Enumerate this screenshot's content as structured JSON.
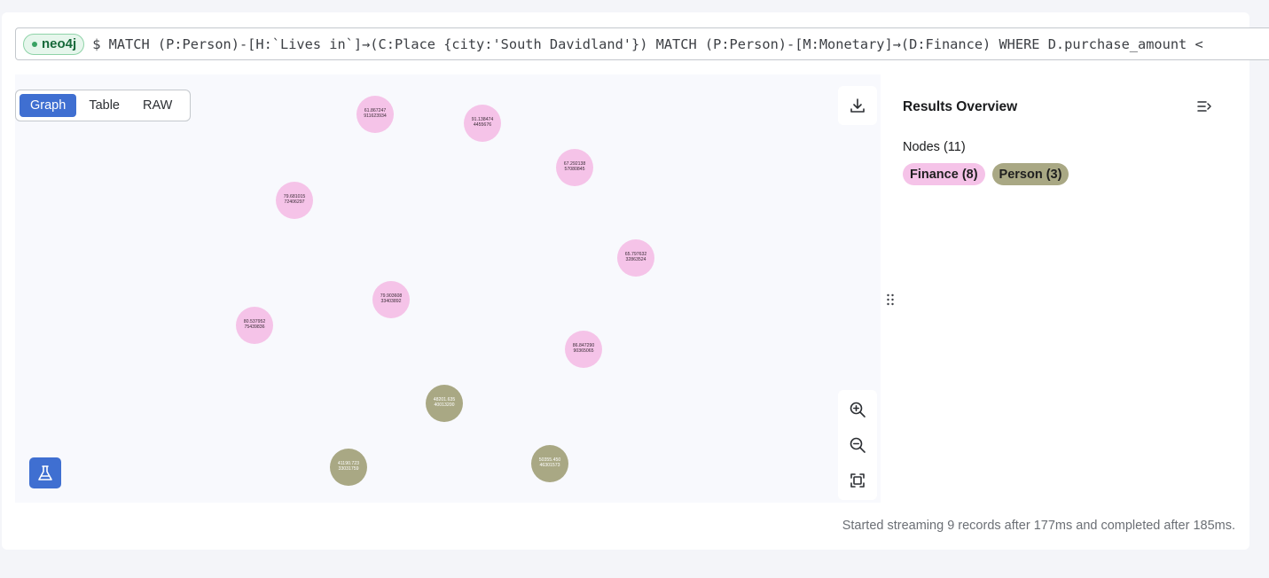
{
  "query_bar": {
    "database_badge": "neo4j",
    "query": "$ MATCH (P:Person)-[H:`Lives in`]→(C:Place {city:'South Davidland'}) MATCH (P:Person)-[M:Monetary]→(D:Finance) WHERE D.purchase_amount <"
  },
  "view_tabs": [
    "Graph",
    "Table",
    "RAW"
  ],
  "active_view": "Graph",
  "icons": {
    "download": "download-icon",
    "zoom_in": "zoom-in-icon",
    "zoom_out": "zoom-out-icon",
    "fit": "zoom-to-fit-icon",
    "sandbox": "flask-icon",
    "collapse": "collapse-panel-icon"
  },
  "graph": {
    "nodes": [
      {
        "label": "Finance",
        "line1": "61.867247",
        "line2": "911623934"
      },
      {
        "label": "Finance",
        "line1": "91.138474",
        "line2": "4455676"
      },
      {
        "label": "Finance",
        "line1": "67.292138",
        "line2": "57080845"
      },
      {
        "label": "Finance",
        "line1": "79.681015",
        "line2": "72406297"
      },
      {
        "label": "Finance",
        "line1": "65.797632",
        "line2": "32863524"
      },
      {
        "label": "Finance",
        "line1": "79.903608",
        "line2": "33403892"
      },
      {
        "label": "Finance",
        "line1": "80.537952",
        "line2": "75439836"
      },
      {
        "label": "Finance",
        "line1": "86.847290",
        "line2": "90365065"
      },
      {
        "label": "Person",
        "line1": "48201.635",
        "line2": "40013200"
      },
      {
        "label": "Person",
        "line1": "41190.723",
        "line2": "33031759"
      },
      {
        "label": "Person",
        "line1": "50355.450",
        "line2": "46301573"
      }
    ]
  },
  "results_overview": {
    "title": "Results Overview",
    "nodes_label": "Nodes (11)",
    "labels": [
      {
        "name": "Finance (8)",
        "color": "#f5c3e8"
      },
      {
        "name": "Person (3)",
        "color": "#a9a884"
      }
    ]
  },
  "colors": {
    "accent": "#3f6fd1",
    "finance_node": "#f5c3e8",
    "person_node": "#a9a884",
    "db_badge": "#17693a"
  },
  "status": "Started streaming 9 records after 177ms and completed after 185ms."
}
